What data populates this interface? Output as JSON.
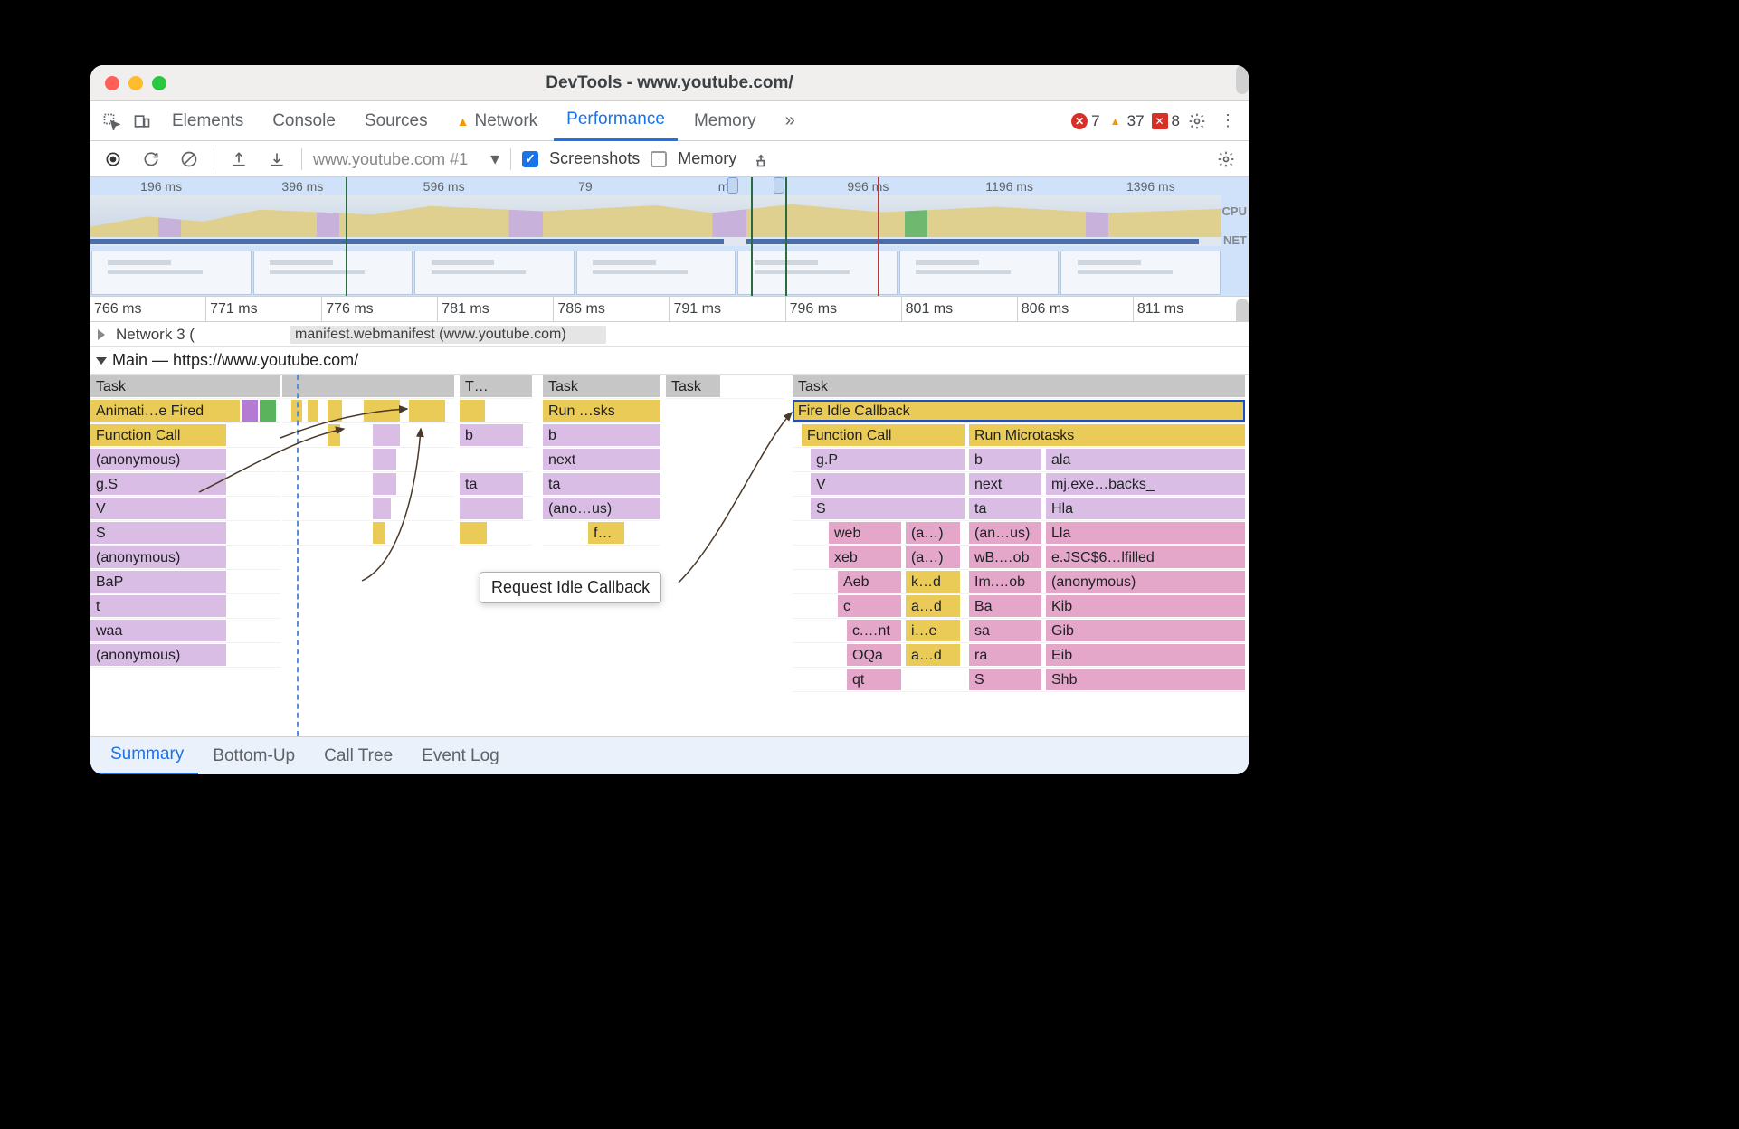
{
  "window": {
    "title": "DevTools - www.youtube.com/"
  },
  "panel_tabs": {
    "elements": "Elements",
    "console": "Console",
    "sources": "Sources",
    "network": "Network",
    "performance": "Performance",
    "memory": "Memory",
    "more": "»"
  },
  "status_counts": {
    "errors": "7",
    "warnings": "37",
    "issues": "8"
  },
  "perf_toolbar": {
    "recording_selector": "www.youtube.com #1",
    "screenshots_label": "Screenshots",
    "memory_label": "Memory",
    "screenshots_checked": true,
    "memory_checked": false
  },
  "overview": {
    "ticks": [
      "196 ms",
      "396 ms",
      "596 ms",
      "79",
      "ms",
      "996 ms",
      "1196 ms",
      "1396 ms"
    ],
    "side_labels": {
      "cpu": "CPU",
      "net": "NET"
    }
  },
  "detail_ruler": {
    "ticks": [
      "766 ms",
      "771 ms",
      "776 ms",
      "781 ms",
      "786 ms",
      "791 ms",
      "796 ms",
      "801 ms",
      "806 ms",
      "811 ms"
    ]
  },
  "network_section": {
    "label": "Network 3 (",
    "manifest_bar": "manifest.webmanifest (www.youtube.com)"
  },
  "main_section": {
    "label": "Main — https://www.youtube.com/"
  },
  "flame": {
    "col0": {
      "task": "Task",
      "anim": "Animati…e Fired",
      "fc": "Function Call",
      "anon1": "(anonymous)",
      "gs": "g.S",
      "v": "V",
      "s": "S",
      "anon2": "(anonymous)",
      "bap": "BaP",
      "t": "t",
      "waa": "waa",
      "anon3": "(anonymous)"
    },
    "col_mid_task1": "T…",
    "col_mid_b": "b",
    "col_mid_ta": "ta",
    "col2": {
      "task": "Task",
      "run": "Run …sks",
      "b": "b",
      "next": "next",
      "ta": "ta",
      "anon": "(ano…us)",
      "f": "f…"
    },
    "col3_task": "Task",
    "col4": {
      "task": "Task",
      "fire": "Fire Idle Callback",
      "fc": "Function Call",
      "rm": "Run Microtasks",
      "gp": "g.P",
      "v": "V",
      "s": "S",
      "b": "b",
      "next": "next",
      "ta": "ta",
      "ala": "ala",
      "mjexe": "mj.exe…backs_",
      "hla": "Hla",
      "web": "web",
      "a1": "(a…)",
      "anus": "(an…us)",
      "lla": "Lla",
      "xeb": "xeb",
      "a2": "(a…)",
      "wbob": "wB.…ob",
      "ejsc": "e.JSC$6…lfilled",
      "aeb": "Aeb",
      "kd": "k…d",
      "imob": "Im.…ob",
      "anon": "(anonymous)",
      "c": "c",
      "ad1": "a…d",
      "ba": "Ba",
      "kib": "Kib",
      "cnt": "c.…nt",
      "ie": "i…e",
      "sa": "sa",
      "gib": "Gib",
      "oqa": "OQa",
      "ad2": "a…d",
      "ra": "ra",
      "eib": "Eib",
      "qt": "qt",
      "scap": "S",
      "shb": "Shb"
    }
  },
  "tooltip": "Request Idle Callback",
  "bottom_tabs": {
    "summary": "Summary",
    "bottomup": "Bottom-Up",
    "calltree": "Call Tree",
    "eventlog": "Event Log"
  }
}
